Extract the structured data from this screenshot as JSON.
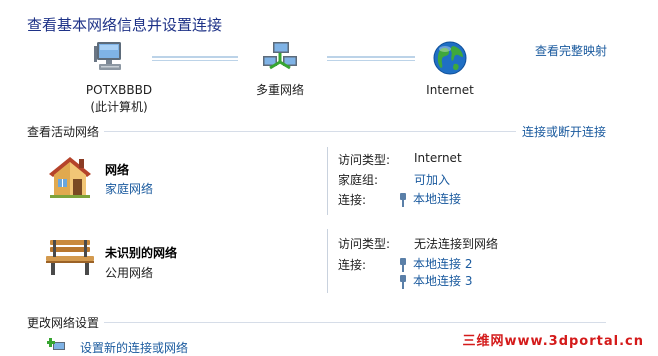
{
  "header": {
    "title": "查看基本网络信息并设置连接",
    "view_full_map": "查看完整映射"
  },
  "network_map": {
    "nodes": [
      {
        "line1": "POTXBBBD",
        "line2": "(此计算机)",
        "icon": "computer-icon"
      },
      {
        "line1": "多重网络",
        "line2": "",
        "icon": "multiple-networks-icon"
      },
      {
        "line1": "Internet",
        "line2": "",
        "icon": "globe-icon"
      }
    ]
  },
  "active_networks": {
    "title": "查看活动网络",
    "connect_disconnect": "连接或断开连接",
    "networks": [
      {
        "name": "网络",
        "type": "家庭网络",
        "icon": "house-icon",
        "details": [
          {
            "key": "访问类型:",
            "value": "Internet",
            "link": false
          },
          {
            "key": "家庭组:",
            "value": "可加入",
            "link": true
          },
          {
            "key": "连接:",
            "value": "本地连接",
            "link": true
          }
        ]
      },
      {
        "name": "未识别的网络",
        "type": "公用网络",
        "icon": "park-bench-icon",
        "details": [
          {
            "key": "访问类型:",
            "value": "无法连接到网络",
            "link": false
          },
          {
            "key": "连接:",
            "value": "本地连接 2",
            "link": true
          },
          {
            "key": "",
            "value": "本地连接 3",
            "link": true
          }
        ]
      }
    ]
  },
  "change_settings": {
    "title": "更改网络设置",
    "setup_new": "设置新的连接或网络"
  },
  "watermark": "三维网www.3dportal.cn",
  "colors": {
    "title": "#1e3287",
    "link": "#1a5a9e",
    "line": "#bcd3e8",
    "watermark": "#d41a1a"
  }
}
